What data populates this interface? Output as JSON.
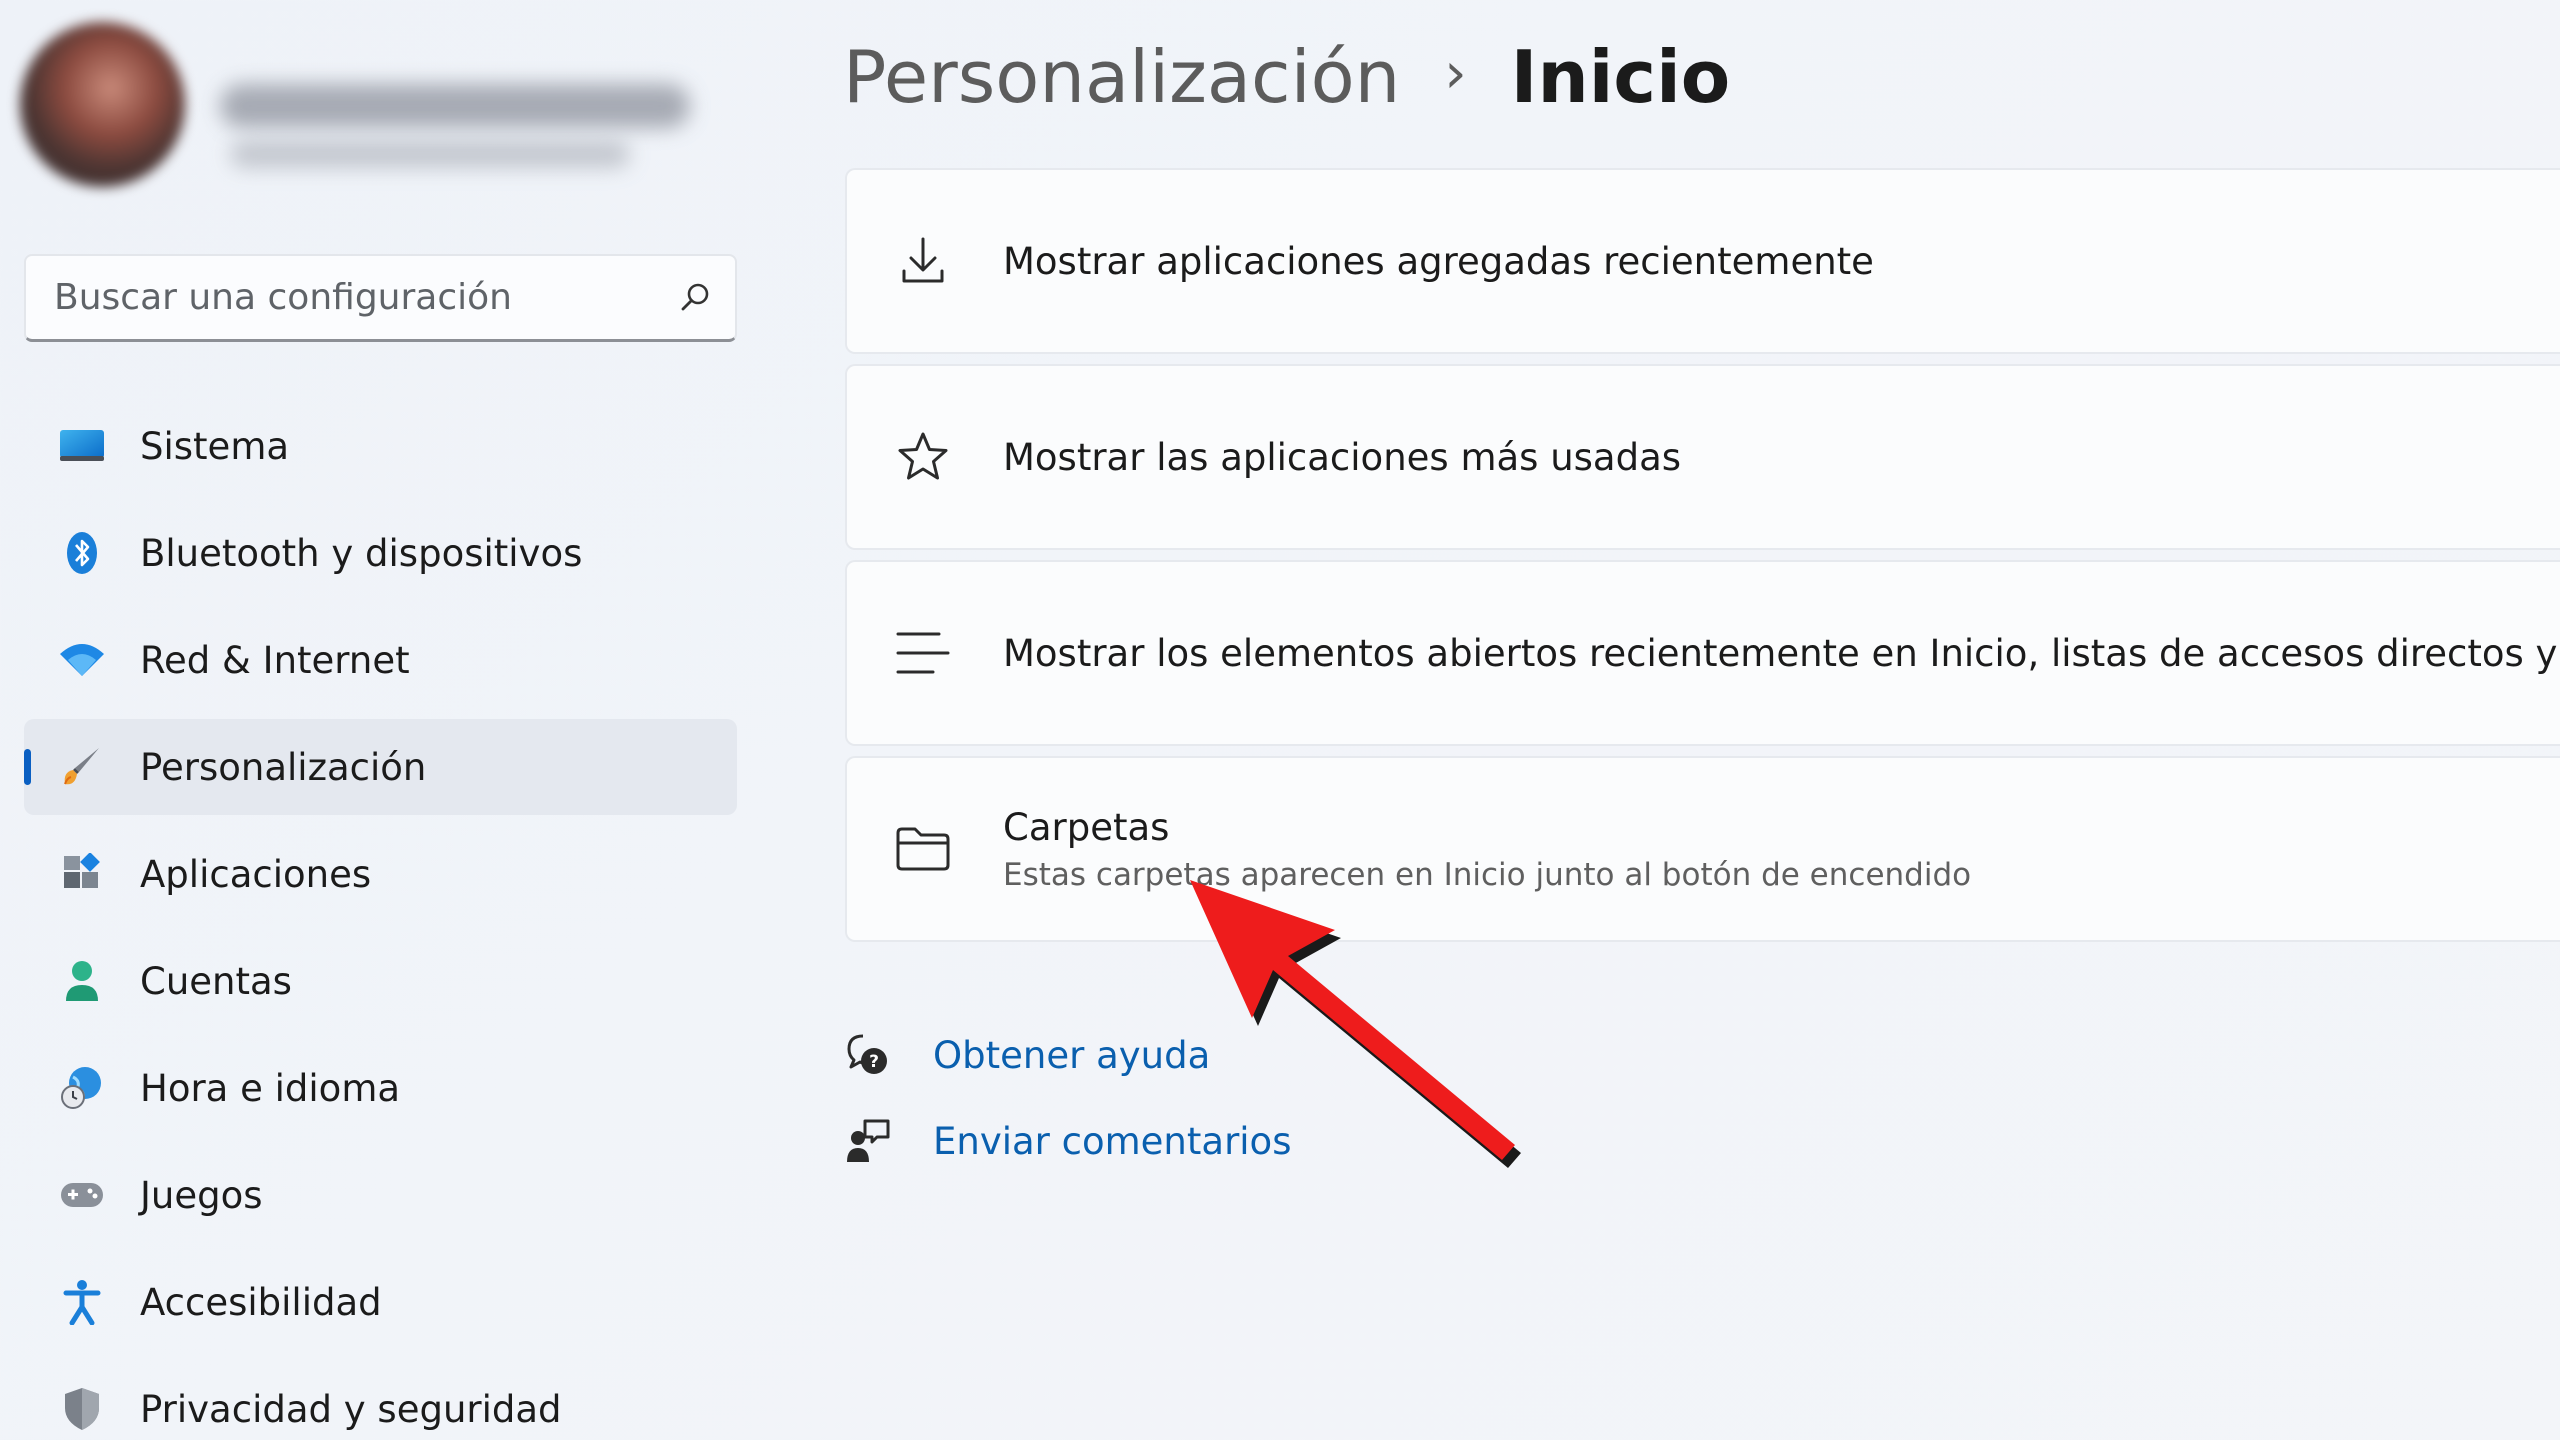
{
  "sidebar": {
    "search": {
      "placeholder": "Buscar una configuración"
    },
    "items": [
      {
        "label": "Sistema",
        "icon": "monitor-icon"
      },
      {
        "label": "Bluetooth y dispositivos",
        "icon": "bluetooth-icon"
      },
      {
        "label": "Red & Internet",
        "icon": "wifi-icon"
      },
      {
        "label": "Personalización",
        "icon": "brush-icon",
        "active": true
      },
      {
        "label": "Aplicaciones",
        "icon": "apps-icon"
      },
      {
        "label": "Cuentas",
        "icon": "person-icon"
      },
      {
        "label": "Hora e idioma",
        "icon": "globe-clock-icon"
      },
      {
        "label": "Juegos",
        "icon": "gamepad-icon"
      },
      {
        "label": "Accesibilidad",
        "icon": "accessibility-icon"
      },
      {
        "label": "Privacidad y seguridad",
        "icon": "shield-icon"
      }
    ]
  },
  "breadcrumb": {
    "parent": "Personalización",
    "separator": "›",
    "current": "Inicio"
  },
  "settings": [
    {
      "title": "Mostrar aplicaciones agregadas recientemente",
      "icon": "download-icon"
    },
    {
      "title": "Mostrar las aplicaciones más usadas",
      "icon": "star-icon"
    },
    {
      "title": "Mostrar los elementos abiertos recientemente en Inicio, listas de accesos directos y el Explorad",
      "icon": "list-icon"
    },
    {
      "title": "Carpetas",
      "subtitle": "Estas carpetas aparecen en Inicio junto al botón de encendido",
      "icon": "folder-icon"
    }
  ],
  "links": {
    "help": "Obtener ayuda",
    "feedback": "Enviar comentarios"
  },
  "colors": {
    "accent": "#0a5fc2",
    "link": "#0a5fae",
    "annotation_arrow": "#ee1c1c"
  }
}
